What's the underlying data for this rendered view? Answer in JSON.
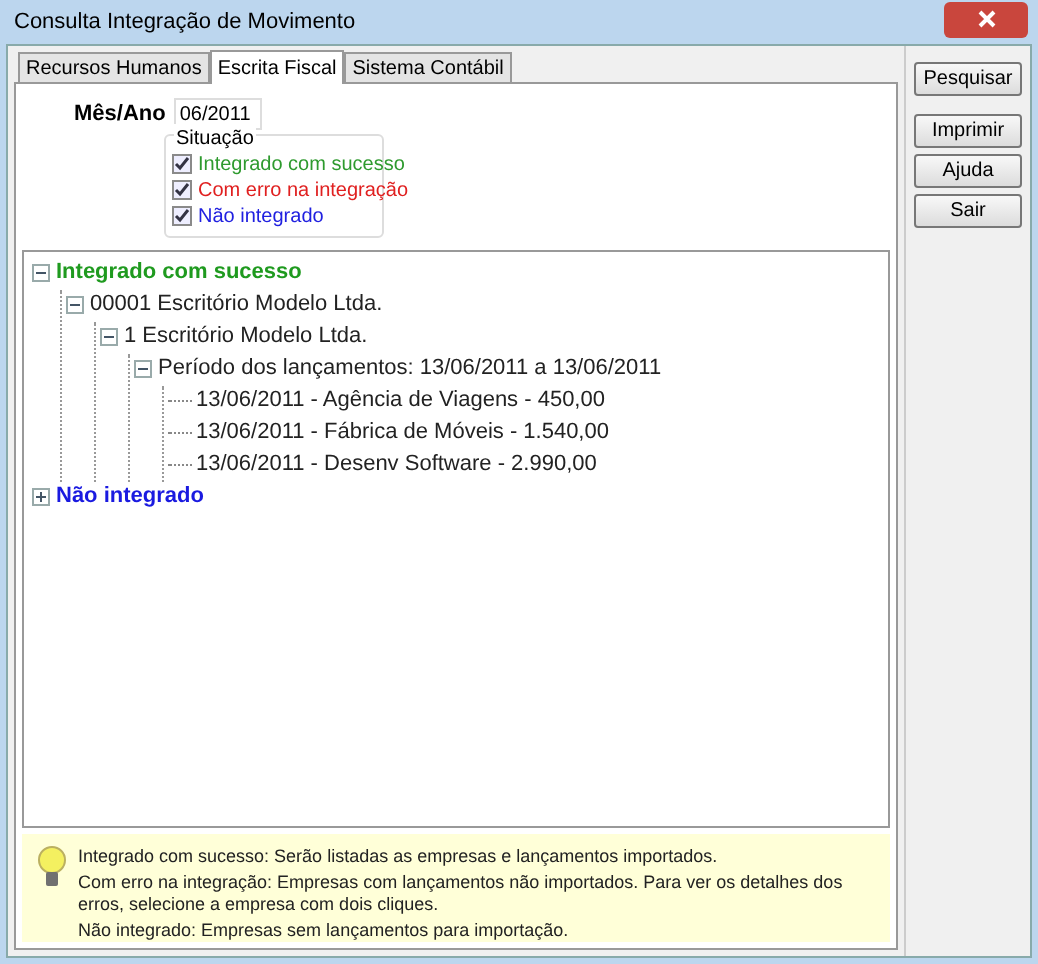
{
  "window": {
    "title": "Consulta Integração de Movimento"
  },
  "tabs": [
    {
      "label": "Recursos Humanos",
      "selected": false
    },
    {
      "label": "Escrita Fiscal",
      "selected": true
    },
    {
      "label": "Sistema Contábil",
      "selected": false
    }
  ],
  "period": {
    "label": "Mês/Ano",
    "value": "06/2011"
  },
  "situation": {
    "title": "Situação",
    "options": [
      {
        "label": "Integrado com sucesso",
        "checked": true,
        "color": "#2e9a2e"
      },
      {
        "label": "Com erro na integração",
        "checked": true,
        "color": "#e02020"
      },
      {
        "label": "Não integrado",
        "checked": true,
        "color": "#2020e0"
      }
    ]
  },
  "tree": [
    {
      "label": "Integrado com sucesso",
      "color": "#1f9a1f",
      "expanded": true,
      "children": [
        {
          "label": "00001 Escritório Modelo Ltda.",
          "expanded": true,
          "children": [
            {
              "label": "1 Escritório Modelo Ltda.",
              "expanded": true,
              "children": [
                {
                  "label": "Período dos lançamentos: 13/06/2011 a 13/06/2011",
                  "expanded": true,
                  "children": [
                    {
                      "label": "13/06/2011 - Agência de Viagens - 450,00"
                    },
                    {
                      "label": "13/06/2011 - Fábrica de Móveis - 1.540,00"
                    },
                    {
                      "label": "13/06/2011 - Desenv Software - 2.990,00"
                    }
                  ]
                }
              ]
            }
          ]
        }
      ]
    },
    {
      "label": "Não integrado",
      "color": "#1a1ae0",
      "expanded": false
    }
  ],
  "info": [
    "Integrado com sucesso: Serão listadas as empresas e lançamentos importados.",
    "Com erro na integração: Empresas com lançamentos não importados. Para ver os detalhes dos erros, selecione a empresa com dois cliques.",
    "Não integrado: Empresas sem lançamentos para importação."
  ],
  "buttons": [
    "Pesquisar",
    "Imprimir",
    "Ajuda",
    "Sair"
  ]
}
